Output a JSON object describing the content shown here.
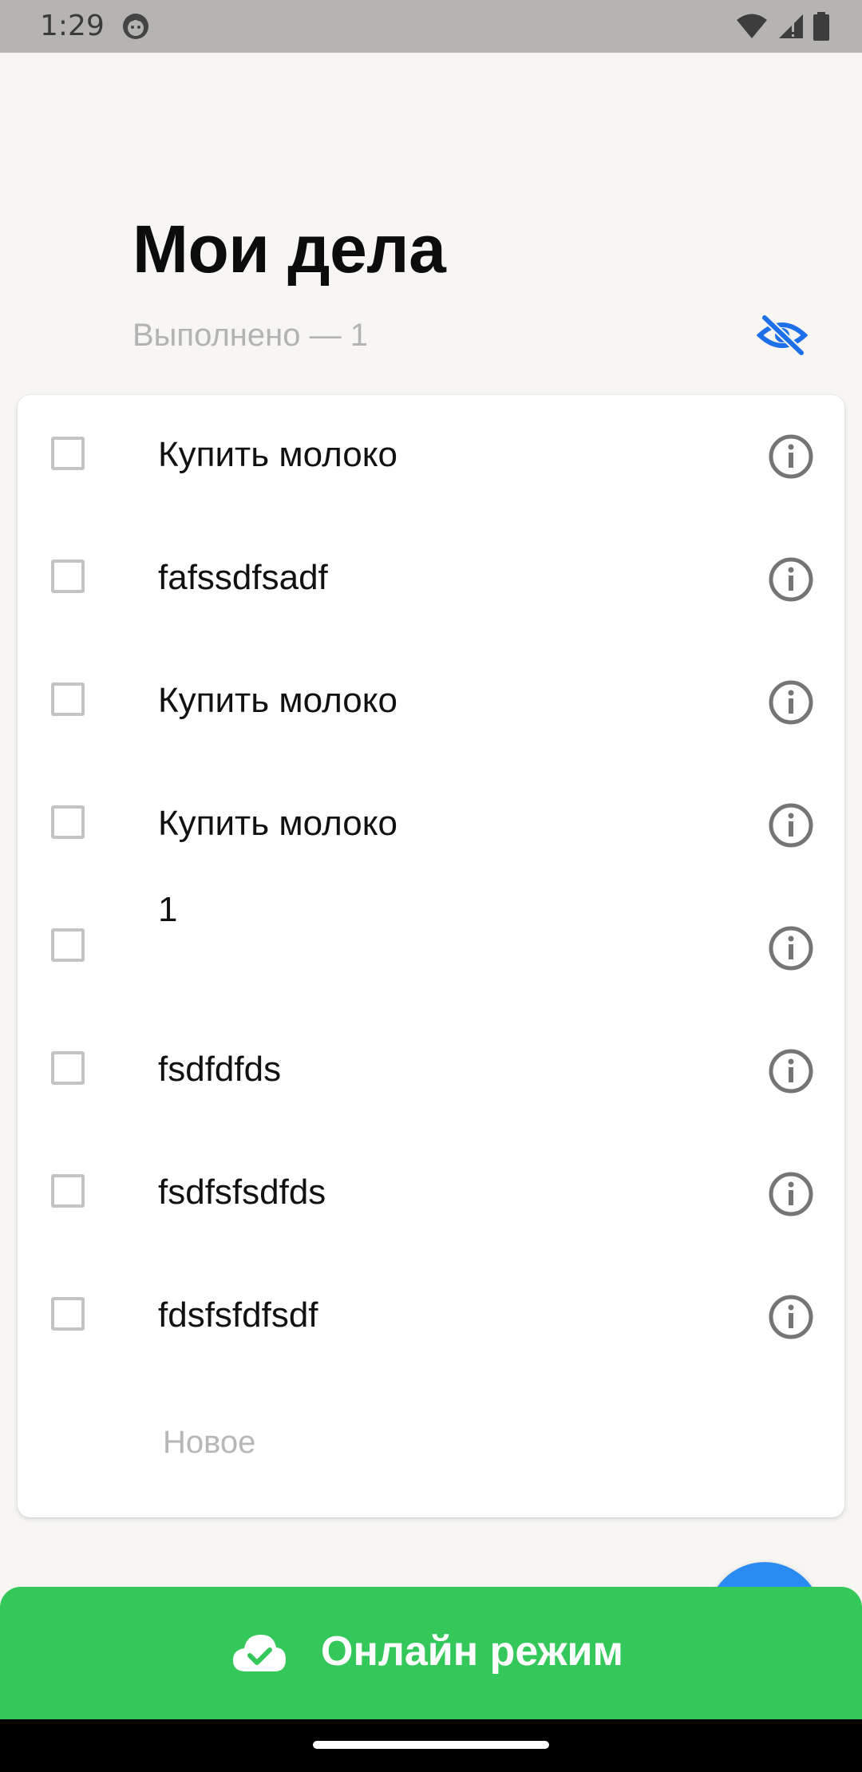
{
  "status_bar": {
    "time": "1:29",
    "icons": [
      "app-notification-icon",
      "wifi-icon",
      "cellular-signal-icon",
      "battery-icon"
    ]
  },
  "header": {
    "title": "Мои дела",
    "subtitle": "Выполнено — 1",
    "visibility_toggle_icon": "eye-off-icon"
  },
  "tasks": [
    {
      "text": "Купить молоко",
      "checked": false
    },
    {
      "text": "fafssdfsadf",
      "checked": false
    },
    {
      "text": "Купить молоко",
      "checked": false
    },
    {
      "text": "Купить молоко",
      "checked": false
    },
    {
      "text": "1",
      "checked": false
    },
    {
      "text": "fsdfdfds",
      "checked": false
    },
    {
      "text": "fsdfsfsdfds",
      "checked": false
    },
    {
      "text": "fdsfsfdfsdf",
      "checked": false
    }
  ],
  "new_task_placeholder": "Новое",
  "banner": {
    "text": "Онлайн режим",
    "icon": "cloud-check-icon",
    "color": "#34C759"
  },
  "colors": {
    "accent": "#2A8CF2",
    "background": "#F7F6F2",
    "checkbox_border": "#C3C3C3",
    "secondary_text": "#B3B3B3"
  }
}
